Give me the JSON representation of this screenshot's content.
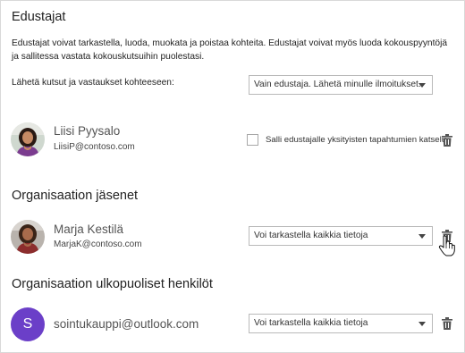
{
  "delegates": {
    "title": "Edustajat",
    "description": "Edustajat voivat tarkastella, luoda, muokata ja poistaa kohteita. Edustajat voivat myös luoda kokouspyyntöjä ja sallitessa vastata kokouskutsuihin puolestasi.",
    "send_label": "Lähetä kutsut ja vastaukset kohteeseen:",
    "send_select_value": "Vain edustaja. Lähetä minulle ilmoitukset.",
    "person": {
      "name": "Liisi Pyysalo",
      "email": "LiisiP@contoso.com"
    },
    "private_checkbox_label": "Salli edustajalle yksityisten tapahtumien katselu"
  },
  "org_members": {
    "title": "Organisaation jäsenet",
    "person": {
      "name": "Marja Kestilä",
      "email": "MarjaK@contoso.com"
    },
    "permission_value": "Voi tarkastella kaikkia tietoja"
  },
  "external": {
    "title": "Organisaation ulkopuoliset henkilöt",
    "person": {
      "avatar_letter": "S",
      "name": "sointukauppi@outlook.com"
    },
    "permission_value": "Voi tarkastella kaikkia tietoja"
  },
  "colors": {
    "external_avatar": "#6b3fc8",
    "trash_icon": "#555555"
  },
  "icons": {
    "delete": "trash-icon",
    "dropdown": "chevron-down-icon",
    "cursor": "hand-pointer-icon"
  }
}
